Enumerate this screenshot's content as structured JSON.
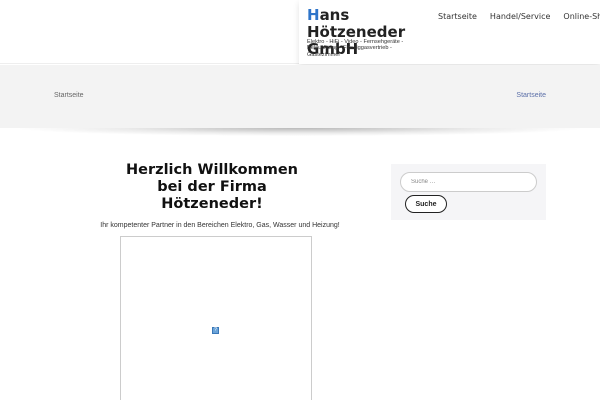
{
  "header": {
    "brand_first_letter": "H",
    "brand_rest": "ans Hötzeneder GmbH",
    "tagline": "Elektro - HiFi - Video - Fernsehgeräte - Beleuchtung - Flüssiggasvertrieb - Gästezimmer",
    "nav": [
      "Startseite",
      "Handel/Service",
      "Online-Shop"
    ]
  },
  "band": {
    "title": "Startseite",
    "breadcrumb": "Startseite"
  },
  "main": {
    "welcome_line1": "Herzlich Willkommen",
    "welcome_line2": "bei der Firma",
    "welcome_line3": "Hötzeneder!",
    "intro": "Ihr kompetenter Partner in den Bereichen Elektro, Gas, Wasser und Heizung!",
    "broken_image_glyph": "?"
  },
  "sidebar": {
    "search_placeholder": "Suche …",
    "search_button": "Suche"
  },
  "colors": {
    "accent": "#2e74c9",
    "breadcrumb_link": "#5b6fa8",
    "band_background": "#f3f3f3"
  }
}
